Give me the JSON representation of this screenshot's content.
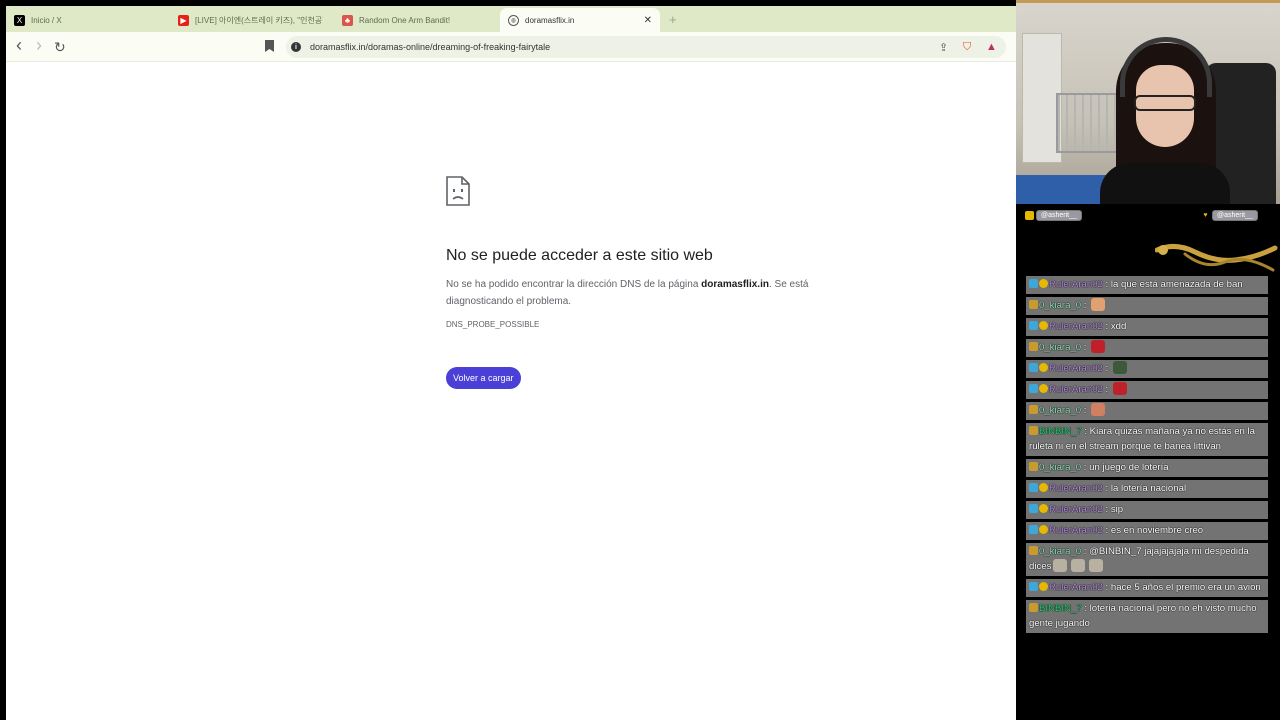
{
  "browser": {
    "tabs": [
      {
        "title": "Inicio / X",
        "icon": "x-logo-icon",
        "active": false
      },
      {
        "title": "[LIVE] 아이엔(스트레이 키즈), \"인천공항",
        "icon": "youtube-icon",
        "active": false
      },
      {
        "title": "Random One Arm Bandit!",
        "icon": "slot-machine-icon",
        "active": false
      },
      {
        "title": "doramasflix.in",
        "icon": "globe-icon",
        "active": true
      }
    ],
    "close_glyph": "✕",
    "new_tab_glyph": "+",
    "url": "doramasflix.in/doramas-online/dreaming-of-freaking-fairytale",
    "back_glyph": "‹",
    "forward_glyph": "›",
    "reload_glyph": "↻"
  },
  "error_page": {
    "title": "No se puede acceder a este sitio web",
    "desc_prefix": "No se ha podido encontrar la dirección DNS de la página ",
    "desc_domain": "doramasflix.in",
    "desc_suffix": ". Se está diagnosticando el problema.",
    "code": "DNS_PROBE_POSSIBLE",
    "reload_label": "Volver a cargar"
  },
  "overlay": {
    "social_left": "@asherit__",
    "social_right": "@asherit__"
  },
  "chat": [
    {
      "badges": [
        "gift",
        "coin"
      ],
      "user": "RulerAran02",
      "ucls": "u-ruler",
      "text": "la que está amenazada de ban",
      "emotes": []
    },
    {
      "badges": [
        "crown"
      ],
      "user": "0_kiara_0",
      "ucls": "u-kiara",
      "text": "",
      "emotes": [
        "#e0a070"
      ]
    },
    {
      "badges": [
        "gift",
        "coin"
      ],
      "user": "RulerAran02",
      "ucls": "u-ruler",
      "text": "xdd",
      "emotes": []
    },
    {
      "badges": [
        "crown"
      ],
      "user": "0_kiara_0",
      "ucls": "u-kiara",
      "text": "",
      "emotes": [
        "#c0202a"
      ]
    },
    {
      "badges": [
        "gift",
        "coin"
      ],
      "user": "RulerAran02",
      "ucls": "u-ruler",
      "text": "",
      "emotes": [
        "#3a5a3a"
      ]
    },
    {
      "badges": [
        "gift",
        "coin"
      ],
      "user": "RulerAran02",
      "ucls": "u-ruler",
      "text": "",
      "emotes": [
        "#c0202a"
      ]
    },
    {
      "badges": [
        "crown"
      ],
      "user": "0_kiara_0",
      "ucls": "u-kiara",
      "text": "",
      "emotes": [
        "#d08060"
      ]
    },
    {
      "badges": [
        "crown"
      ],
      "user": "BINBIN_7",
      "ucls": "u-binbin",
      "text": "Kiara quizás mañana ya no estás en la ruleta ni en el stream porque te banea littivan",
      "emotes": []
    },
    {
      "badges": [
        "crown"
      ],
      "user": "0_kiara_0",
      "ucls": "u-kiara",
      "text": "un juego de lotería",
      "emotes": []
    },
    {
      "badges": [
        "gift",
        "coin"
      ],
      "user": "RulerAran02",
      "ucls": "u-ruler",
      "text": "la lotería nacional",
      "emotes": []
    },
    {
      "badges": [
        "gift",
        "coin"
      ],
      "user": "RulerAran02",
      "ucls": "u-ruler",
      "text": "sip",
      "emotes": []
    },
    {
      "badges": [
        "gift",
        "coin"
      ],
      "user": "RulerAran02",
      "ucls": "u-ruler",
      "text": "es en noviembre creo",
      "emotes": []
    },
    {
      "badges": [
        "crown"
      ],
      "user": "0_kiara_0",
      "ucls": "u-kiara",
      "text": "@BINBIN_7 jajajajajaja mi despedida dices",
      "emotes": [
        "#b8b0a0",
        "#b8b0a0",
        "#b8b0a0"
      ]
    },
    {
      "badges": [
        "gift",
        "coin"
      ],
      "user": "RulerAran02",
      "ucls": "u-ruler",
      "text": "hace 5 años el premio era un avion",
      "emotes": []
    },
    {
      "badges": [
        "crown"
      ],
      "user": "BINBIN_7",
      "ucls": "u-binbin",
      "text": "loteria nacional pero no eh visto mucho gente jugando",
      "emotes": []
    }
  ]
}
